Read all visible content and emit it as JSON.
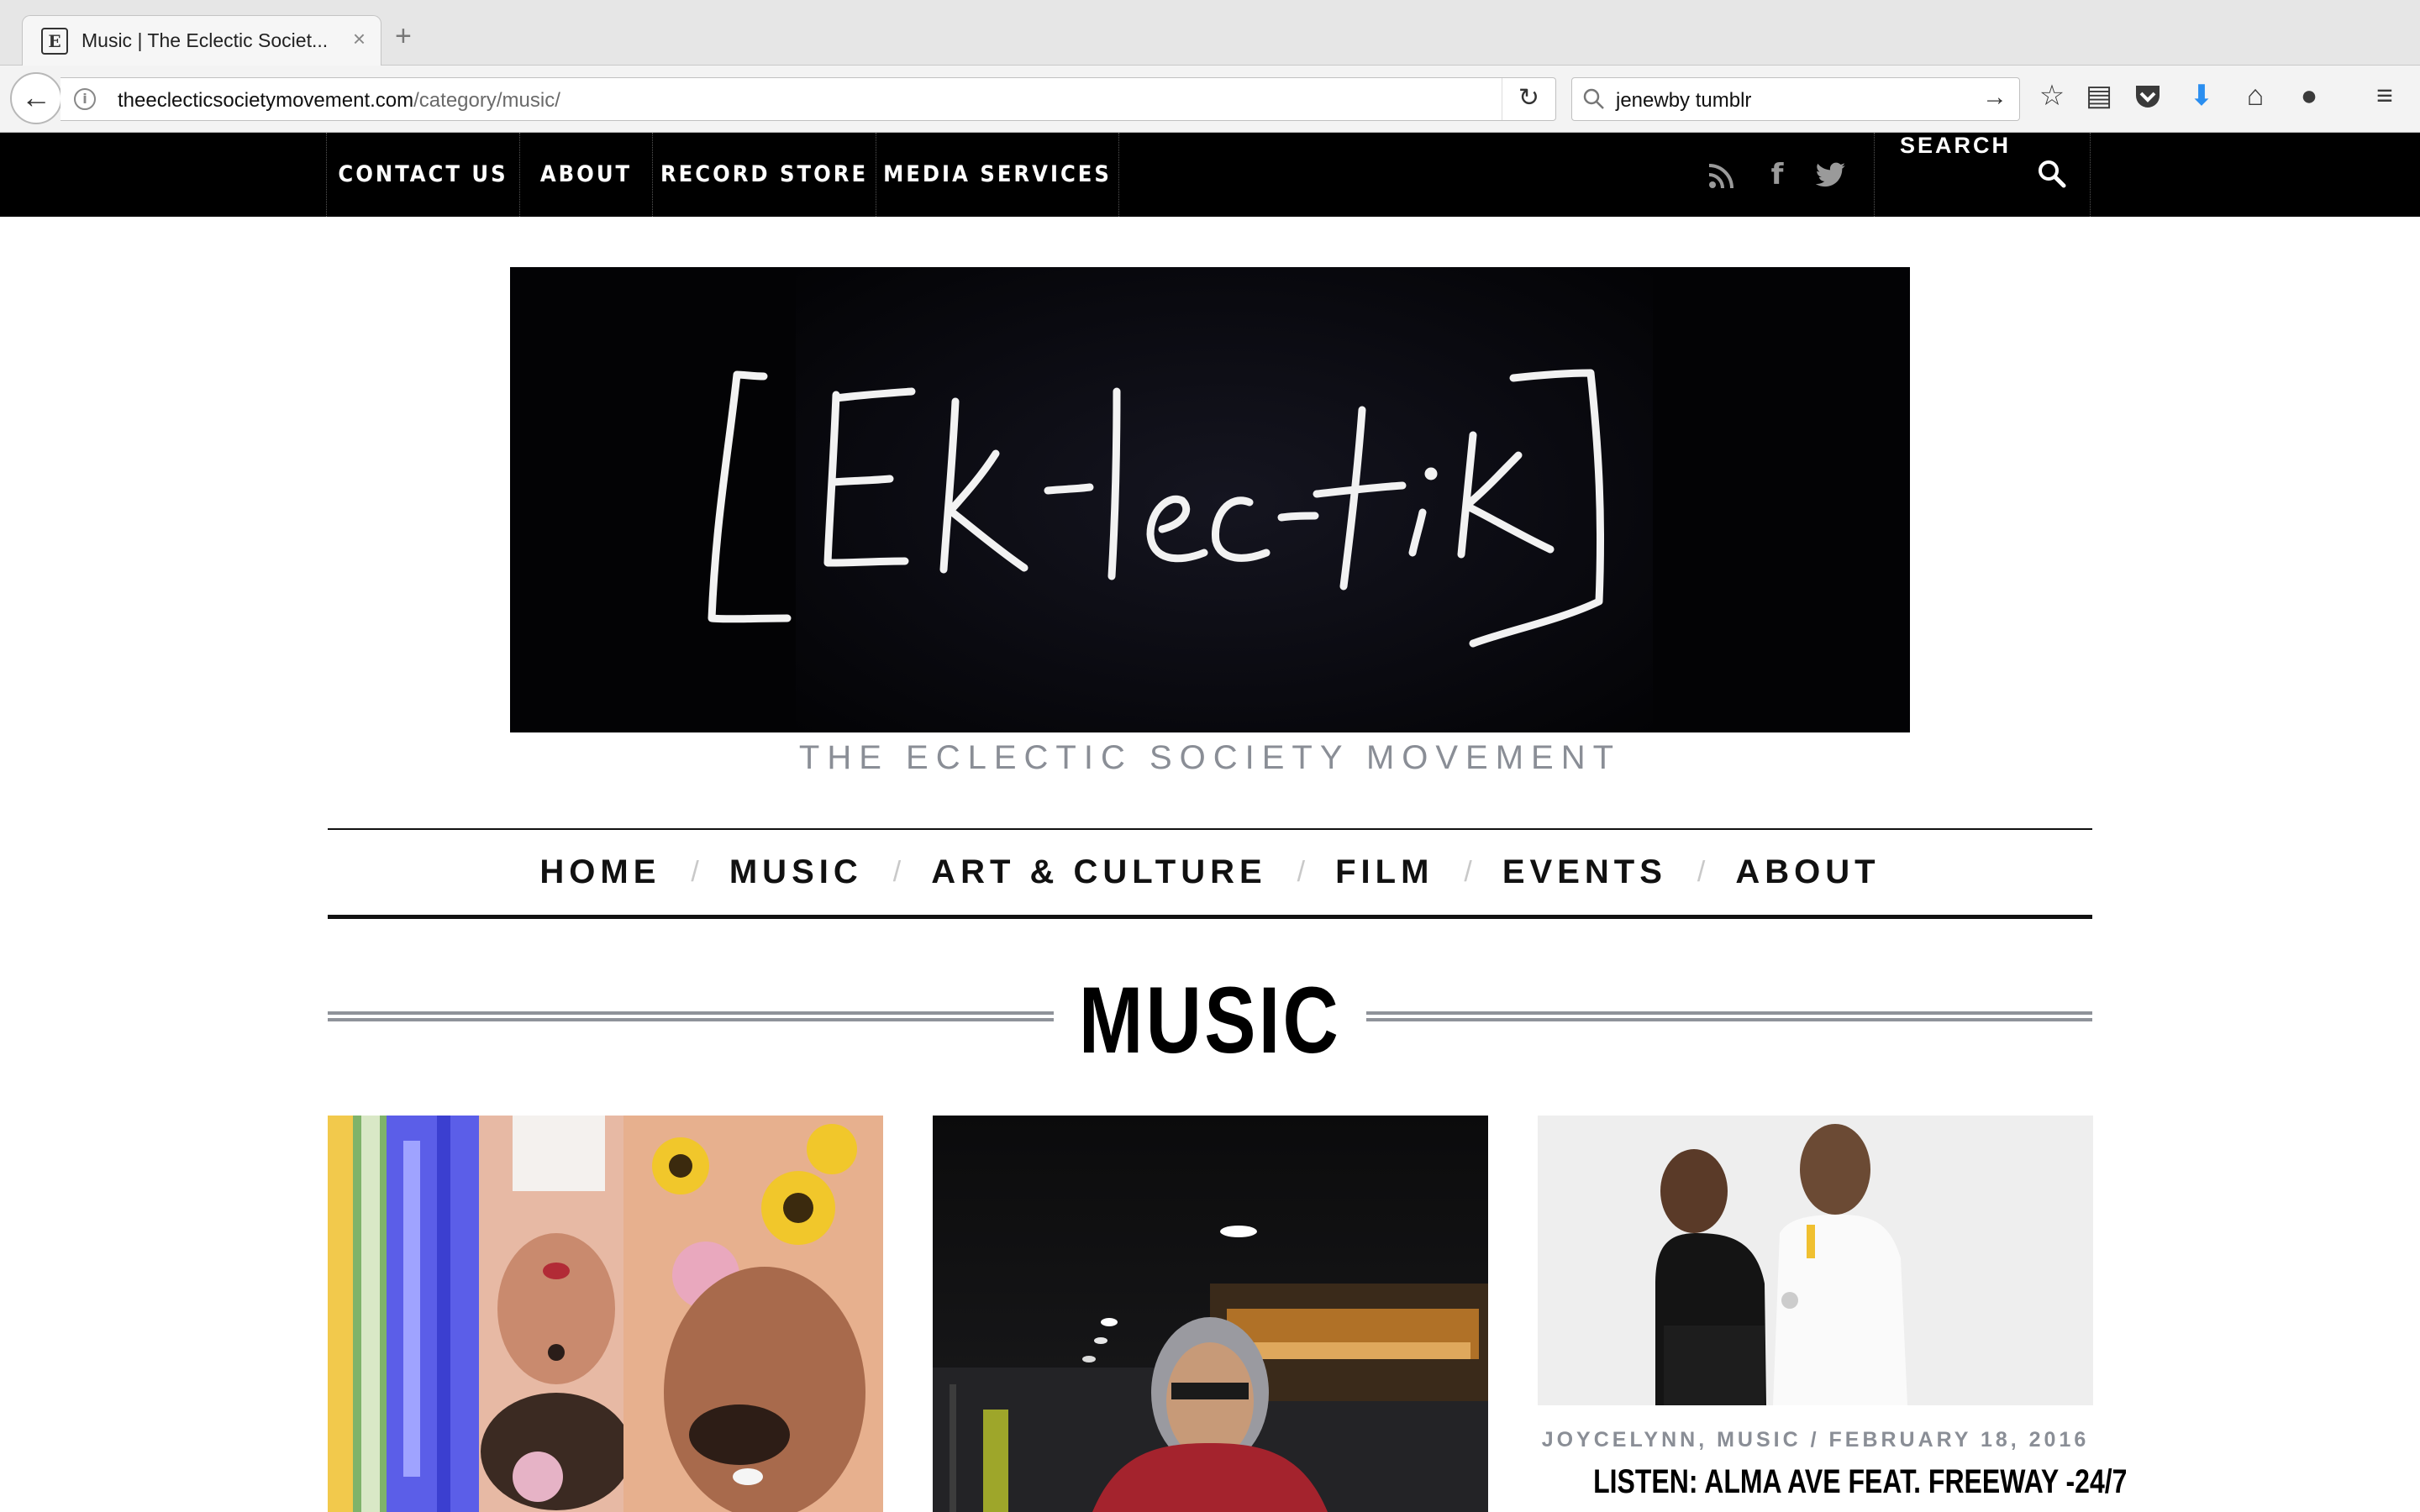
{
  "browser": {
    "tab_title": "Music | The Eclectic Societ...",
    "tab_close": "×",
    "new_tab": "+",
    "url_domain": "theeclecticsocietymovement.com",
    "url_path": "/category/music/",
    "search_query": "jenewby tumblr",
    "favicon_text": "[E]"
  },
  "topbar": {
    "items": [
      {
        "label": "CONTACT US"
      },
      {
        "label": "ABOUT"
      },
      {
        "label": "RECORD STORE"
      },
      {
        "label": "MEDIA SERVICES"
      }
    ],
    "social": [
      "rss-icon",
      "facebook-icon",
      "twitter-icon"
    ],
    "search_label": "SEARCH"
  },
  "logo": {
    "text": "[Ek-lec-tik]",
    "tagline": "THE ECLECTIC SOCIETY MOVEMENT"
  },
  "main_nav": {
    "items": [
      {
        "label": "HOME"
      },
      {
        "label": "MUSIC"
      },
      {
        "label": "ART & CULTURE"
      },
      {
        "label": "FILM"
      },
      {
        "label": "EVENTS"
      },
      {
        "label": "ABOUT"
      }
    ],
    "separator": "/"
  },
  "page": {
    "title": "MUSIC"
  },
  "posts": [
    {
      "meta": "",
      "title": ""
    },
    {
      "meta": "",
      "title": ""
    },
    {
      "meta": "JOYCELYNN, MUSIC / FEBRUARY 18, 2016",
      "title": "LISTEN: ALMA AVE FEAT. FREEWAY -24/7"
    }
  ],
  "colors": {
    "topbar_bg": "#000000",
    "tagline": "#8a8e96",
    "accent_rule": "#8f939a"
  }
}
